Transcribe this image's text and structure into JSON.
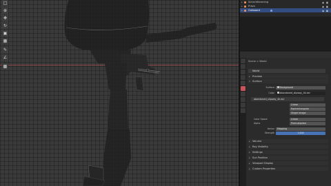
{
  "outliner": {
    "rows": [
      {
        "label": "Schechtlearning",
        "selected": false
      },
      {
        "label": "Prism",
        "selected": false
      },
      {
        "label": "Outboard",
        "selected": true
      }
    ]
  },
  "properties": {
    "breadcrumb": "Scene   >   World",
    "world_name": "World",
    "sections": {
      "preview": "Preview",
      "surface": "Surface",
      "volume": "Volume",
      "ray_visibility": "Ray Visibility",
      "settings": "Settings",
      "sun_position": "Sun Position",
      "viewport_display": "Viewport Display",
      "custom_properties": "Custom Properties"
    },
    "surface": {
      "surface_label": "Surface",
      "surface_value": "Background",
      "color_label": "Color",
      "color_value": "abandoned_slipway_4k.exr",
      "image_name": "abandoned_slipway_4k.exr",
      "interpolation": "Linear",
      "projection": "Equirectangular",
      "extension": "Single Image",
      "color_space_label": "Color Space",
      "color_space": "Linear",
      "alpha_label": "Alpha",
      "alpha": "Premultiplied",
      "vector_label": "Vector",
      "vector": "Mapping",
      "strength_label": "Strength",
      "strength": "1.000"
    }
  },
  "colors": {
    "accent": "#334d80",
    "axis_x": "#a3464a",
    "active_tab": "#c9545a"
  }
}
